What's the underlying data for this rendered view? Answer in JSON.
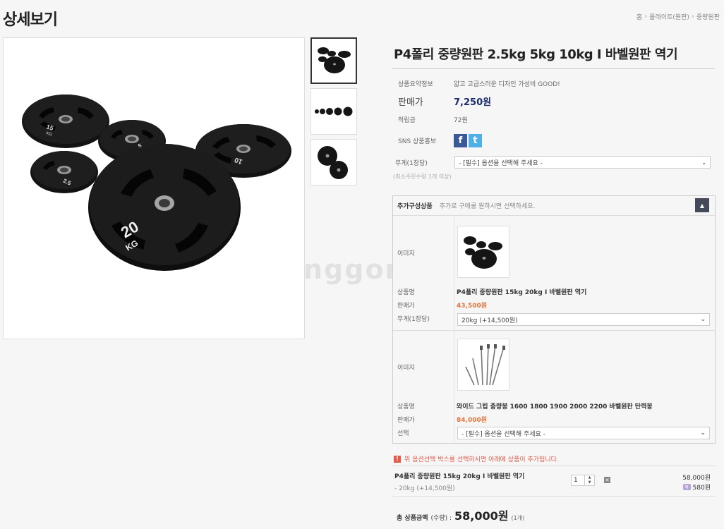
{
  "header": {
    "title": "상세보기",
    "breadcrumb": [
      "홈",
      "플레이트(원판)",
      "중량원판"
    ]
  },
  "product": {
    "title": "P4폴리 중량원판 2.5kg 5kg 10kg I 바벨원판 역기",
    "summary_label": "상품요약정보",
    "summary_value": "얇고 고급스러운 디자인 가성비 GOOD!",
    "price_label": "판매가",
    "price_value": "7,250원",
    "points_label": "적립금",
    "points_value": "72원",
    "sns_label": "SNS 상품홍보",
    "sns_icons": [
      "facebook-icon",
      "twitter-icon"
    ],
    "option_label": "무게(1장당)",
    "option_placeholder": "- [필수] 옵션을 선택해 주세요 -",
    "min_qty": "(최소주문수량 1개 이상)"
  },
  "addon": {
    "title": "추가구성상품",
    "desc": "추가로 구매를 원하시면 선택하세요.",
    "toggle": "▲",
    "items": [
      {
        "image_label": "이미지",
        "name_label": "상품명",
        "name": "P4폴리 중량원판 15kg 20kg I 바벨원판 역기",
        "price_label": "판매가",
        "price": "43,500원",
        "option_label": "무게(1장당)",
        "option_value": "20kg (+14,500원)"
      },
      {
        "image_label": "이미지",
        "name_label": "상품명",
        "name": "와이드 그립 중량봉 1600 1800 1900 2000 2200 바벨원판 탄력봉",
        "price_label": "판매가",
        "price": "84,000원",
        "option_label": "선택",
        "option_value": "- [필수] 옵션을 선택해 주세요 -"
      }
    ]
  },
  "notice": "위 옵션선택 박스를 선택하시면 아래에 상품이 추가됩니다.",
  "selected": {
    "name": "P4폴리 중량원판 15kg 20kg I 바벨원판 역기",
    "option": "- 20kg (+14,500원)",
    "qty": "1",
    "price": "58,000원",
    "points": "580원"
  },
  "total": {
    "label": "총 상품금액",
    "sub": "(수량) :",
    "amount": "58,000원",
    "count": "(1개)"
  },
  "colors": {
    "price_blue": "#1a2c6b",
    "price_orange": "#e5733a",
    "notice_red": "#e05a4a"
  }
}
